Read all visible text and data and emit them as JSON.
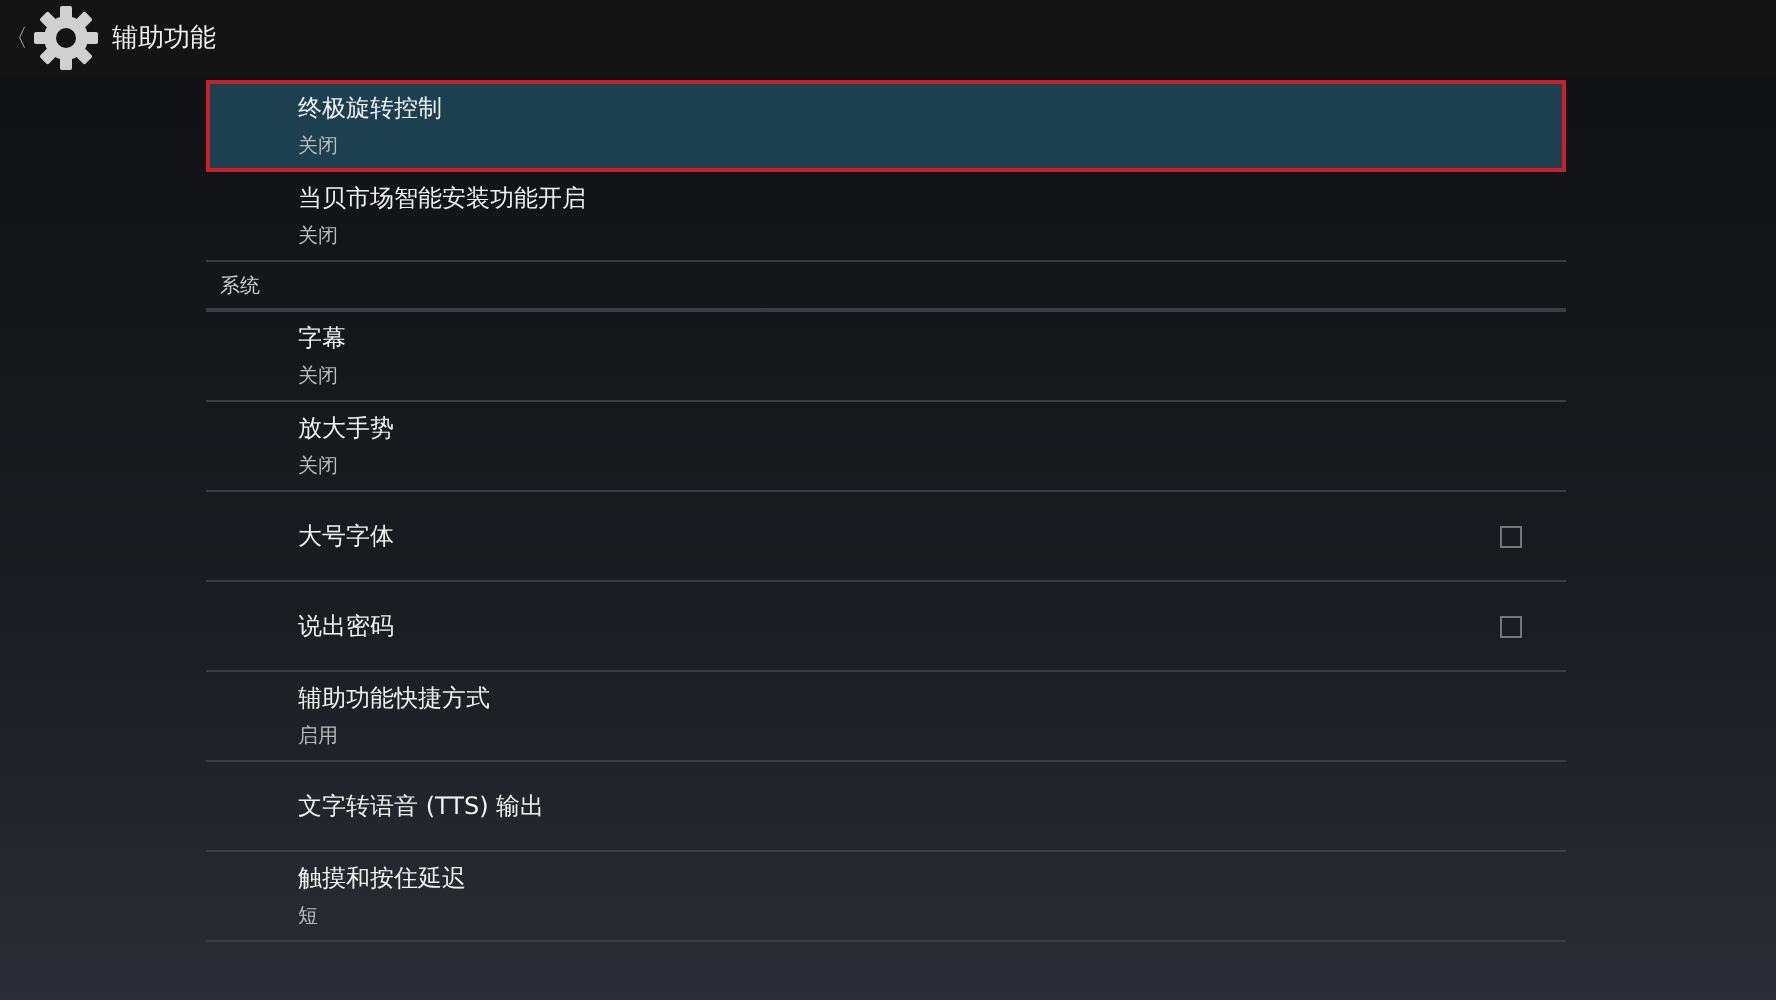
{
  "header": {
    "back": "〈",
    "title": "辅助功能"
  },
  "groups": [
    {
      "items": [
        {
          "kind": "summary",
          "title": "终极旋转控制",
          "summary": "关闭",
          "selected": true
        },
        {
          "kind": "summary",
          "title": "当贝市场智能安装功能开启",
          "summary": "关闭",
          "selected": false
        }
      ]
    },
    {
      "heading": "系统",
      "items": [
        {
          "kind": "summary",
          "title": "字幕",
          "summary": "关闭",
          "selected": false
        },
        {
          "kind": "summary",
          "title": "放大手势",
          "summary": "关闭",
          "selected": false
        },
        {
          "kind": "checkbox",
          "title": "大号字体",
          "checked": false,
          "selected": false
        },
        {
          "kind": "checkbox",
          "title": "说出密码",
          "checked": false,
          "selected": false
        },
        {
          "kind": "summary",
          "title": "辅助功能快捷方式",
          "summary": "启用",
          "selected": false
        },
        {
          "kind": "plain",
          "title": "文字转语音 (TTS) 输出",
          "selected": false
        },
        {
          "kind": "summary",
          "title": "触摸和按住延迟",
          "summary": "短",
          "selected": false
        }
      ]
    }
  ]
}
